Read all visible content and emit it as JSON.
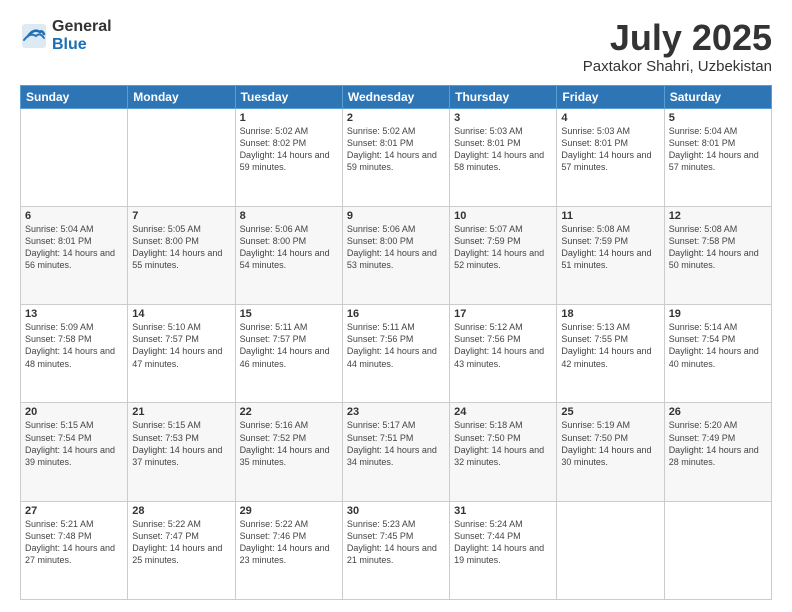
{
  "header": {
    "logo_general": "General",
    "logo_blue": "Blue",
    "month_title": "July 2025",
    "location": "Paxtakor Shahri, Uzbekistan"
  },
  "days": [
    "Sunday",
    "Monday",
    "Tuesday",
    "Wednesday",
    "Thursday",
    "Friday",
    "Saturday"
  ],
  "weeks": [
    [
      {
        "date": "",
        "sunrise": "",
        "sunset": "",
        "daylight": ""
      },
      {
        "date": "",
        "sunrise": "",
        "sunset": "",
        "daylight": ""
      },
      {
        "date": "1",
        "sunrise": "Sunrise: 5:02 AM",
        "sunset": "Sunset: 8:02 PM",
        "daylight": "Daylight: 14 hours and 59 minutes."
      },
      {
        "date": "2",
        "sunrise": "Sunrise: 5:02 AM",
        "sunset": "Sunset: 8:01 PM",
        "daylight": "Daylight: 14 hours and 59 minutes."
      },
      {
        "date": "3",
        "sunrise": "Sunrise: 5:03 AM",
        "sunset": "Sunset: 8:01 PM",
        "daylight": "Daylight: 14 hours and 58 minutes."
      },
      {
        "date": "4",
        "sunrise": "Sunrise: 5:03 AM",
        "sunset": "Sunset: 8:01 PM",
        "daylight": "Daylight: 14 hours and 57 minutes."
      },
      {
        "date": "5",
        "sunrise": "Sunrise: 5:04 AM",
        "sunset": "Sunset: 8:01 PM",
        "daylight": "Daylight: 14 hours and 57 minutes."
      }
    ],
    [
      {
        "date": "6",
        "sunrise": "Sunrise: 5:04 AM",
        "sunset": "Sunset: 8:01 PM",
        "daylight": "Daylight: 14 hours and 56 minutes."
      },
      {
        "date": "7",
        "sunrise": "Sunrise: 5:05 AM",
        "sunset": "Sunset: 8:00 PM",
        "daylight": "Daylight: 14 hours and 55 minutes."
      },
      {
        "date": "8",
        "sunrise": "Sunrise: 5:06 AM",
        "sunset": "Sunset: 8:00 PM",
        "daylight": "Daylight: 14 hours and 54 minutes."
      },
      {
        "date": "9",
        "sunrise": "Sunrise: 5:06 AM",
        "sunset": "Sunset: 8:00 PM",
        "daylight": "Daylight: 14 hours and 53 minutes."
      },
      {
        "date": "10",
        "sunrise": "Sunrise: 5:07 AM",
        "sunset": "Sunset: 7:59 PM",
        "daylight": "Daylight: 14 hours and 52 minutes."
      },
      {
        "date": "11",
        "sunrise": "Sunrise: 5:08 AM",
        "sunset": "Sunset: 7:59 PM",
        "daylight": "Daylight: 14 hours and 51 minutes."
      },
      {
        "date": "12",
        "sunrise": "Sunrise: 5:08 AM",
        "sunset": "Sunset: 7:58 PM",
        "daylight": "Daylight: 14 hours and 50 minutes."
      }
    ],
    [
      {
        "date": "13",
        "sunrise": "Sunrise: 5:09 AM",
        "sunset": "Sunset: 7:58 PM",
        "daylight": "Daylight: 14 hours and 48 minutes."
      },
      {
        "date": "14",
        "sunrise": "Sunrise: 5:10 AM",
        "sunset": "Sunset: 7:57 PM",
        "daylight": "Daylight: 14 hours and 47 minutes."
      },
      {
        "date": "15",
        "sunrise": "Sunrise: 5:11 AM",
        "sunset": "Sunset: 7:57 PM",
        "daylight": "Daylight: 14 hours and 46 minutes."
      },
      {
        "date": "16",
        "sunrise": "Sunrise: 5:11 AM",
        "sunset": "Sunset: 7:56 PM",
        "daylight": "Daylight: 14 hours and 44 minutes."
      },
      {
        "date": "17",
        "sunrise": "Sunrise: 5:12 AM",
        "sunset": "Sunset: 7:56 PM",
        "daylight": "Daylight: 14 hours and 43 minutes."
      },
      {
        "date": "18",
        "sunrise": "Sunrise: 5:13 AM",
        "sunset": "Sunset: 7:55 PM",
        "daylight": "Daylight: 14 hours and 42 minutes."
      },
      {
        "date": "19",
        "sunrise": "Sunrise: 5:14 AM",
        "sunset": "Sunset: 7:54 PM",
        "daylight": "Daylight: 14 hours and 40 minutes."
      }
    ],
    [
      {
        "date": "20",
        "sunrise": "Sunrise: 5:15 AM",
        "sunset": "Sunset: 7:54 PM",
        "daylight": "Daylight: 14 hours and 39 minutes."
      },
      {
        "date": "21",
        "sunrise": "Sunrise: 5:15 AM",
        "sunset": "Sunset: 7:53 PM",
        "daylight": "Daylight: 14 hours and 37 minutes."
      },
      {
        "date": "22",
        "sunrise": "Sunrise: 5:16 AM",
        "sunset": "Sunset: 7:52 PM",
        "daylight": "Daylight: 14 hours and 35 minutes."
      },
      {
        "date": "23",
        "sunrise": "Sunrise: 5:17 AM",
        "sunset": "Sunset: 7:51 PM",
        "daylight": "Daylight: 14 hours and 34 minutes."
      },
      {
        "date": "24",
        "sunrise": "Sunrise: 5:18 AM",
        "sunset": "Sunset: 7:50 PM",
        "daylight": "Daylight: 14 hours and 32 minutes."
      },
      {
        "date": "25",
        "sunrise": "Sunrise: 5:19 AM",
        "sunset": "Sunset: 7:50 PM",
        "daylight": "Daylight: 14 hours and 30 minutes."
      },
      {
        "date": "26",
        "sunrise": "Sunrise: 5:20 AM",
        "sunset": "Sunset: 7:49 PM",
        "daylight": "Daylight: 14 hours and 28 minutes."
      }
    ],
    [
      {
        "date": "27",
        "sunrise": "Sunrise: 5:21 AM",
        "sunset": "Sunset: 7:48 PM",
        "daylight": "Daylight: 14 hours and 27 minutes."
      },
      {
        "date": "28",
        "sunrise": "Sunrise: 5:22 AM",
        "sunset": "Sunset: 7:47 PM",
        "daylight": "Daylight: 14 hours and 25 minutes."
      },
      {
        "date": "29",
        "sunrise": "Sunrise: 5:22 AM",
        "sunset": "Sunset: 7:46 PM",
        "daylight": "Daylight: 14 hours and 23 minutes."
      },
      {
        "date": "30",
        "sunrise": "Sunrise: 5:23 AM",
        "sunset": "Sunset: 7:45 PM",
        "daylight": "Daylight: 14 hours and 21 minutes."
      },
      {
        "date": "31",
        "sunrise": "Sunrise: 5:24 AM",
        "sunset": "Sunset: 7:44 PM",
        "daylight": "Daylight: 14 hours and 19 minutes."
      },
      {
        "date": "",
        "sunrise": "",
        "sunset": "",
        "daylight": ""
      },
      {
        "date": "",
        "sunrise": "",
        "sunset": "",
        "daylight": ""
      }
    ]
  ]
}
